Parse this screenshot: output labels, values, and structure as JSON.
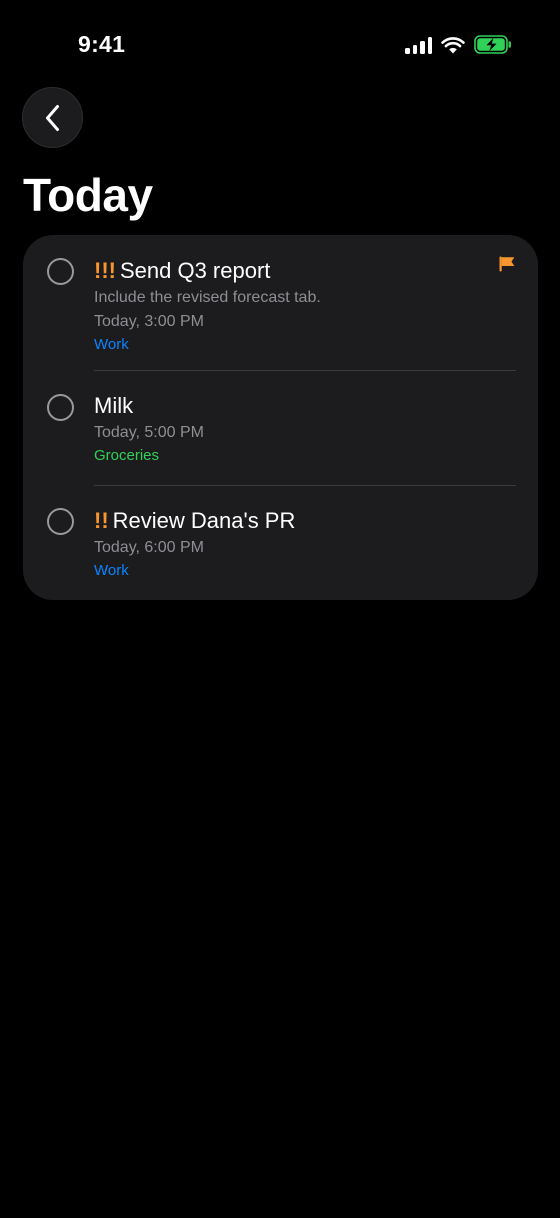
{
  "status_bar": {
    "time": "9:41"
  },
  "page": {
    "title": "Today"
  },
  "colors": {
    "background": "#000000",
    "card": "#1c1c1e",
    "priority": "#f7962f",
    "flag": "#f7962f",
    "work": "#0a84ff",
    "groceries": "#30d158",
    "battery": "#30d158",
    "secondary_text": "#8e8e93"
  },
  "reminders": [
    {
      "priority": "!!!",
      "title": "Send Q3 report",
      "notes": "Include the revised forecast tab.",
      "due": "Today, 3:00 PM",
      "list": "Work",
      "flagged": true
    },
    {
      "priority": "",
      "title": "Milk",
      "notes": "",
      "due": "Today, 5:00 PM",
      "list": "Groceries",
      "flagged": false
    },
    {
      "priority": "!!",
      "title": "Review Dana's PR",
      "notes": "",
      "due": "Today, 6:00 PM",
      "list": "Work",
      "flagged": false
    }
  ],
  "icons": {
    "back": "chevron-left-icon",
    "signal": "cellular-signal-icon",
    "wifi": "wifi-icon",
    "battery": "battery-charging-icon",
    "flag": "flag-icon",
    "checkbox": "circle-icon"
  }
}
